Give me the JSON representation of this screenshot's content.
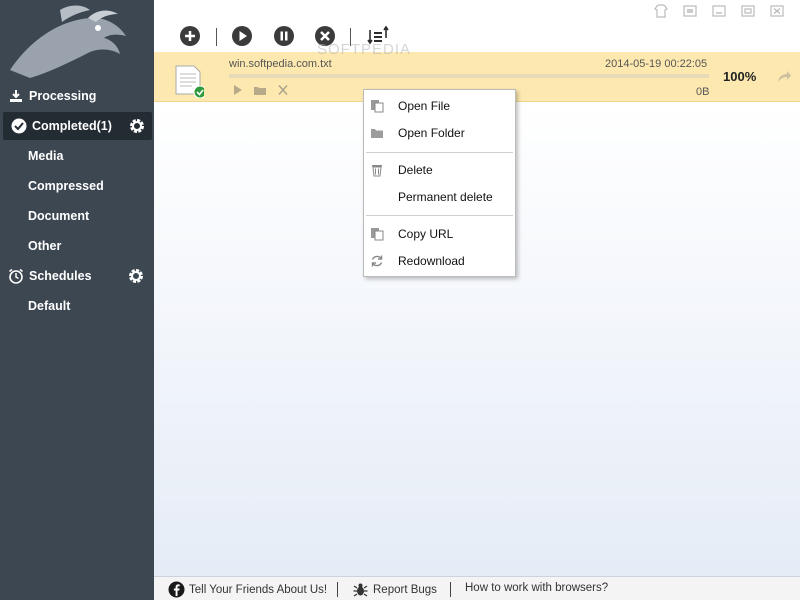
{
  "sidebar": {
    "items": [
      {
        "label": "Processing",
        "icon": "download-tray-icon"
      },
      {
        "label": "Completed(1)",
        "icon": "check-circle-icon",
        "active": true
      },
      {
        "label": "Media"
      },
      {
        "label": "Compressed"
      },
      {
        "label": "Document"
      },
      {
        "label": "Other"
      },
      {
        "label": "Schedules",
        "icon": "alarm-clock-icon"
      },
      {
        "label": "Default"
      }
    ]
  },
  "toolbar": {
    "buttons": [
      "add-icon",
      "play-icon",
      "pause-icon",
      "stop-icon",
      "sort-icon"
    ]
  },
  "download": {
    "filename": "win.softpedia.com.txt",
    "date": "2014-05-19 00:22:05",
    "percent_label": "100%",
    "progress": 1.0,
    "size": "0B"
  },
  "watermark": "SOFTPEDIA",
  "context_menu": {
    "items": [
      {
        "label": "Open File",
        "icon": "copy-file-icon"
      },
      {
        "label": "Open Folder",
        "icon": "folder-icon"
      },
      {
        "label": "Delete",
        "icon": "trash-icon"
      },
      {
        "label": "Permanent delete",
        "icon": ""
      },
      {
        "label": "Copy URL",
        "icon": "copy-file-icon"
      },
      {
        "label": "Redownload",
        "icon": "refresh-icon"
      }
    ]
  },
  "footer": {
    "tell_friends": "Tell Your Friends About Us!",
    "report_bugs": "Report Bugs",
    "how_to": "How to work with browsers?"
  },
  "colors": {
    "sidebar": "#3d4752",
    "sidebar_active": "#232b33",
    "row_highlight": "#fde9b0",
    "toolbar_icon": "#3b3b3b"
  }
}
